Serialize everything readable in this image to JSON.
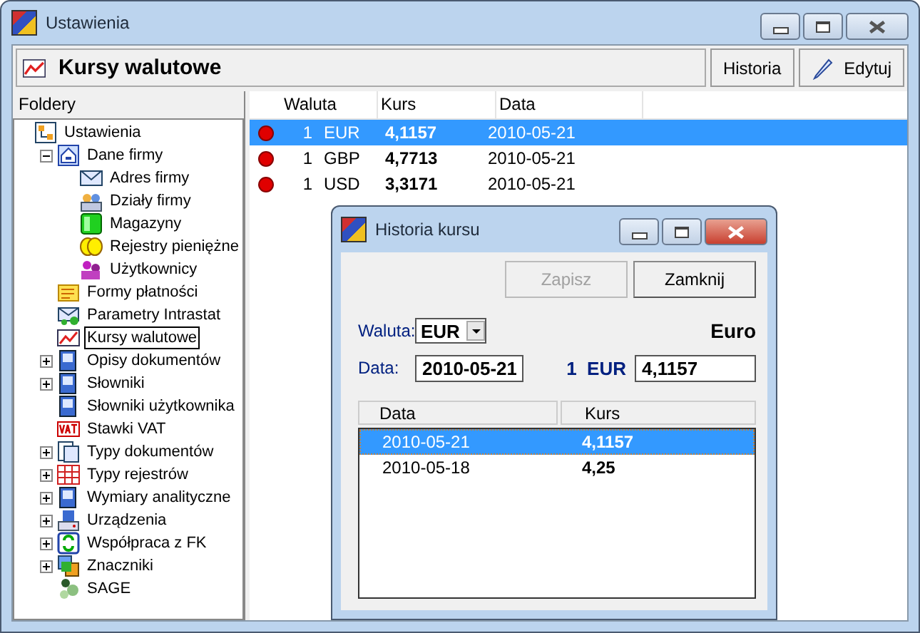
{
  "window": {
    "title": "Ustawienia"
  },
  "header": {
    "title": "Kursy walutowe",
    "buttons": [
      {
        "label": "Historia",
        "kind": "plain"
      },
      {
        "label": "Edytuj",
        "kind": "edit"
      }
    ]
  },
  "sidebar": {
    "title": "Foldery",
    "tree": [
      {
        "label": "Ustawienia",
        "kind": "settings",
        "selected": false,
        "children": [
          {
            "label": "Dane firmy",
            "kind": "company",
            "selected": false,
            "expanded": true,
            "children": [
              {
                "label": "Adres firmy",
                "kind": "mail",
                "selected": false
              },
              {
                "label": "Działy firmy",
                "kind": "people",
                "selected": false
              },
              {
                "label": "Magazyny",
                "kind": "warehouse",
                "selected": false
              },
              {
                "label": "Rejestry pieniężne",
                "kind": "coins",
                "selected": false
              },
              {
                "label": "Użytkownicy",
                "kind": "users",
                "selected": false
              }
            ]
          },
          {
            "label": "Formy płatności",
            "kind": "form",
            "selected": false
          },
          {
            "label": "Parametry Intrastat",
            "kind": "intrastat",
            "selected": false
          },
          {
            "label": "Kursy walutowe",
            "kind": "chart",
            "selected": true
          },
          {
            "label": "Opisy dokumentów",
            "kind": "document",
            "selected": false,
            "expanded": false
          },
          {
            "label": "Słowniki",
            "kind": "document",
            "selected": false,
            "expanded": false
          },
          {
            "label": "Słowniki użytkownika",
            "kind": "document",
            "selected": false
          },
          {
            "label": "Stawki VAT",
            "kind": "vat",
            "selected": false
          },
          {
            "label": "Typy dokumentów",
            "kind": "pages",
            "selected": false,
            "expanded": false
          },
          {
            "label": "Typy rejestrów",
            "kind": "grid",
            "selected": false,
            "expanded": false
          },
          {
            "label": "Wymiary analityczne",
            "kind": "document",
            "selected": false,
            "expanded": false
          },
          {
            "label": "Urządzenia",
            "kind": "device",
            "selected": false,
            "expanded": false
          },
          {
            "label": "Współpraca z FK",
            "kind": "sync",
            "selected": false,
            "expanded": false
          },
          {
            "label": "Znaczniki",
            "kind": "tags",
            "selected": false,
            "expanded": false
          },
          {
            "label": "SAGE",
            "kind": "dots",
            "selected": false
          }
        ]
      }
    ]
  },
  "table": {
    "columns": [
      "Waluta",
      "Kurs",
      "Data"
    ],
    "rows": [
      {
        "color": "#e00000",
        "quantity": "1",
        "currency": "EUR",
        "rate": "4,1157",
        "date": "2010-05-21",
        "selected": true
      },
      {
        "color": "#e00000",
        "quantity": "1",
        "currency": "GBP",
        "rate": "4,7713",
        "date": "2010-05-21",
        "selected": false
      },
      {
        "color": "#e00000",
        "quantity": "1",
        "currency": "USD",
        "rate": "3,3171",
        "date": "2010-05-21",
        "selected": false
      }
    ]
  },
  "dialog": {
    "title": "Historia kursu",
    "buttons": [
      {
        "label": "Zapisz",
        "disabled": true
      },
      {
        "label": "Zamknij",
        "disabled": false
      }
    ],
    "currency_label": "Waluta:",
    "currency_value": "EUR",
    "currency_name": "Euro",
    "date_label": "Data:",
    "date_value": "2010-05-21",
    "unit_label": "1  EUR",
    "rate_value": "4,1157",
    "history": {
      "columns": [
        "Data",
        "Kurs"
      ],
      "rows": [
        {
          "date": "2010-05-21",
          "rate": "4,1157",
          "selected": true
        },
        {
          "date": "2010-05-18",
          "rate": "4,25",
          "selected": false
        }
      ]
    }
  }
}
